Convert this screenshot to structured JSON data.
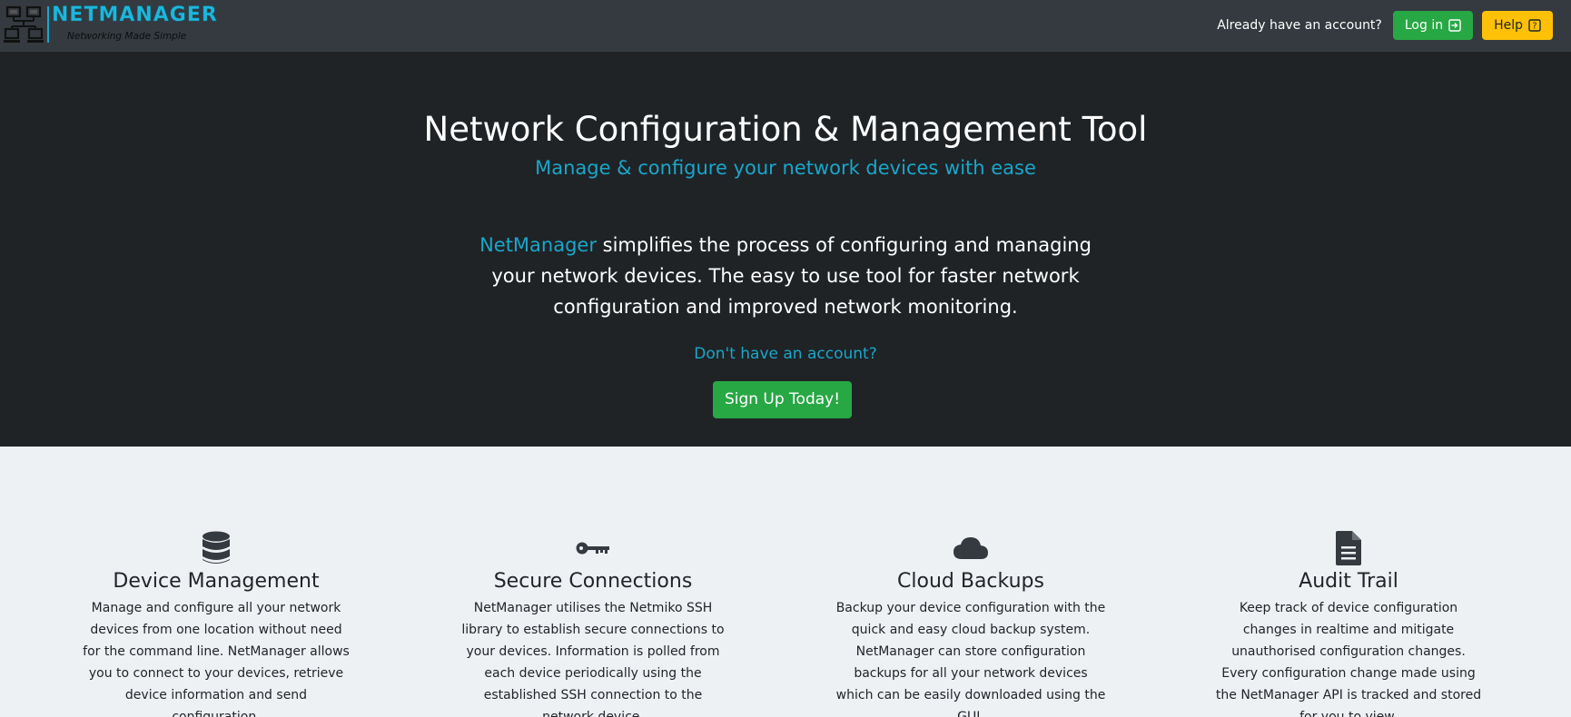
{
  "navbar": {
    "brand_name": "NETMANAGER",
    "brand_tagline": "Networking Made Simple",
    "account_prompt": "Already have an account?",
    "login_label": "Log in",
    "help_label": "Help",
    "login_icon": "sign-in-icon",
    "help_icon": "question-icon"
  },
  "hero": {
    "title": "Network Configuration & Management Tool",
    "subtitle": "Manage & configure your network devices with ease",
    "desc_accent": "NetManager",
    "desc_rest": " simplifies the process of configuring and managing your network devices. The easy to use tool for faster network configuration and improved network monitoring.",
    "question": "Don't have an account?",
    "signup_label": "Sign Up Today!"
  },
  "features": [
    {
      "icon": "database-icon",
      "title": "Device Management",
      "text": "Manage and configure all your network devices from one location without need for the command line. NetManager allows you to connect to your devices, retrieve device information and send configuration."
    },
    {
      "icon": "key-icon",
      "title": "Secure Connections",
      "text": "NetManager utilises the Netmiko SSH library to establish secure connections to your devices. Information is polled from each device periodically using the established SSH connection to the network device."
    },
    {
      "icon": "cloud-icon",
      "title": "Cloud Backups",
      "text": "Backup your device configuration with the quick and easy cloud backup system. NetManager can store configuration backups for all your network devices which can be easily downloaded using the GUI."
    },
    {
      "icon": "file-icon",
      "title": "Audit Trail",
      "text": "Keep track of device configuration changes in realtime and mitigate unauthorised configuration changes. Every configuration change made using the NetManager API is tracked and stored for you to view."
    }
  ],
  "colors": {
    "navbar_bg": "#343a40",
    "hero_bg": "#1f2326",
    "accent": "#1aa6c9",
    "success": "#28a745",
    "warning": "#ffc107",
    "features_bg": "#eef1f4"
  }
}
